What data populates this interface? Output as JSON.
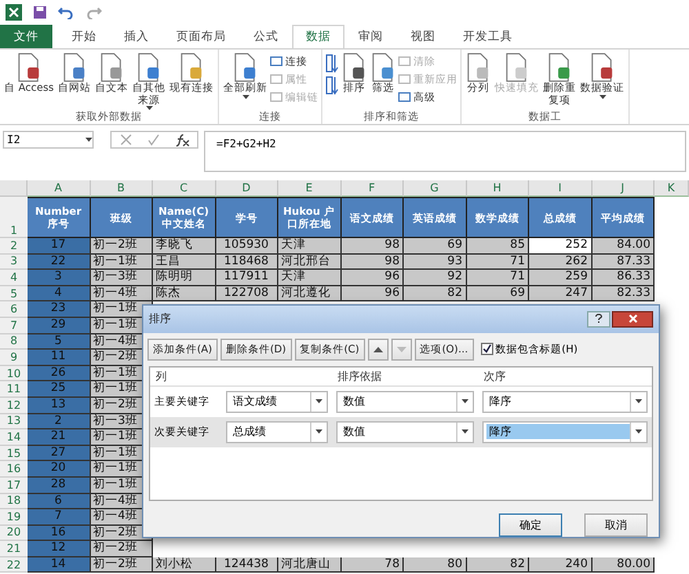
{
  "tabs": [
    {
      "label": "文件",
      "kind": "file",
      "selected": false
    },
    {
      "label": "开始",
      "kind": "tab",
      "selected": false
    },
    {
      "label": "插入",
      "kind": "tab",
      "selected": false
    },
    {
      "label": "页面布局",
      "kind": "tab",
      "selected": false
    },
    {
      "label": "公式",
      "kind": "tab",
      "selected": false
    },
    {
      "label": "数据",
      "kind": "tab",
      "selected": true
    },
    {
      "label": "审阅",
      "kind": "tab",
      "selected": false
    },
    {
      "label": "视图",
      "kind": "tab",
      "selected": false
    },
    {
      "label": "开发工具",
      "kind": "tab",
      "selected": false
    }
  ],
  "ribbon": {
    "groups": [
      {
        "title": "获取外部数据",
        "items": [
          {
            "kind": "large",
            "label": "自 Access",
            "dropdown": false
          },
          {
            "kind": "large",
            "label": "自网站",
            "dropdown": false
          },
          {
            "kind": "large",
            "label": "自文本",
            "dropdown": false
          },
          {
            "kind": "large",
            "label": "自其他来源",
            "dropdown": true
          },
          {
            "kind": "large",
            "label": "现有连接",
            "dropdown": false
          }
        ]
      },
      {
        "title": "连接",
        "items": [
          {
            "kind": "large",
            "label": "全部刷新",
            "dropdown": true
          },
          {
            "kind": "small",
            "label": "连接",
            "disabled": false
          },
          {
            "kind": "small",
            "label": "属性",
            "disabled": true
          },
          {
            "kind": "small",
            "label": "编辑链",
            "disabled": true
          }
        ]
      },
      {
        "title": "排序和筛选",
        "items": [
          {
            "kind": "sortpair"
          },
          {
            "kind": "large",
            "label": "排序",
            "dropdown": false
          },
          {
            "kind": "large",
            "label": "筛选",
            "dropdown": false
          },
          {
            "kind": "small",
            "label": "清除",
            "disabled": true
          },
          {
            "kind": "small",
            "label": "重新应用",
            "disabled": true
          },
          {
            "kind": "small",
            "label": "高级",
            "disabled": false
          }
        ]
      },
      {
        "title": "数据工",
        "items": [
          {
            "kind": "large",
            "label": "分列",
            "dropdown": false,
            "disabled": false
          },
          {
            "kind": "large",
            "label": "快速填充",
            "dropdown": false,
            "disabled": true
          },
          {
            "kind": "large",
            "label": "删除重复项",
            "dropdown": false,
            "disabled": false
          },
          {
            "kind": "large",
            "label": "数据验证",
            "dropdown": true,
            "disabled": false
          }
        ]
      }
    ]
  },
  "formula_bar": {
    "name_box": "I2",
    "formula": "=F2+G2+H2"
  },
  "sheet": {
    "columns": [
      "A",
      "B",
      "C",
      "D",
      "E",
      "F",
      "G",
      "H",
      "I",
      "J",
      "K"
    ],
    "header_row": {
      "number": "1",
      "cells": [
        "Number 序号",
        "班级",
        "Name(C) 中文姓名",
        "学号",
        "Hukou 户口所在地",
        "语文成绩",
        "英语成绩",
        "数学成绩",
        "总成绩",
        "平均成绩"
      ]
    },
    "rows": [
      {
        "number": "2",
        "cells": [
          "17",
          "初一2班",
          "李晓飞",
          "105930",
          "天津",
          "98",
          "69",
          "85",
          {
            "text": "252",
            "active": true
          },
          "84.00"
        ]
      },
      {
        "number": "3",
        "cells": [
          "22",
          "初一1班",
          "王昌",
          "118468",
          "河北邢台",
          "98",
          "93",
          "71",
          "262",
          "87.33"
        ]
      },
      {
        "number": "4",
        "cells": [
          "3",
          "初一3班",
          "陈明明",
          "117911",
          "天津",
          "96",
          "92",
          "71",
          "259",
          "86.33"
        ]
      },
      {
        "number": "5",
        "cells": [
          "4",
          "初一4班",
          "陈杰",
          "122708",
          "河北遵化",
          "96",
          "82",
          "69",
          "247",
          "82.33"
        ]
      },
      {
        "number": "6",
        "cells": [
          "23",
          "初一1班"
        ]
      },
      {
        "number": "7",
        "cells": [
          "29",
          "初一1班"
        ]
      },
      {
        "number": "8",
        "cells": [
          "5",
          "初一4班"
        ]
      },
      {
        "number": "9",
        "cells": [
          "11",
          "初一2班"
        ]
      },
      {
        "number": "10",
        "cells": [
          "26",
          "初一1班"
        ]
      },
      {
        "number": "11",
        "cells": [
          "25",
          "初一1班"
        ]
      },
      {
        "number": "12",
        "cells": [
          "13",
          "初一2班"
        ]
      },
      {
        "number": "13",
        "cells": [
          "2",
          "初一3班"
        ]
      },
      {
        "number": "14",
        "cells": [
          "21",
          "初一1班"
        ]
      },
      {
        "number": "15",
        "cells": [
          "27",
          "初一1班"
        ]
      },
      {
        "number": "16",
        "cells": [
          "20",
          "初一1班"
        ]
      },
      {
        "number": "17",
        "cells": [
          "28",
          "初一1班"
        ]
      },
      {
        "number": "18",
        "cells": [
          "6",
          "初一4班"
        ]
      },
      {
        "number": "19",
        "cells": [
          "7",
          "初一4班"
        ]
      },
      {
        "number": "20",
        "cells": [
          "16",
          "初一2班"
        ]
      },
      {
        "number": "21",
        "cells": [
          "12",
          "初一2班"
        ]
      },
      {
        "number": "22",
        "cells": [
          "14",
          "初一2班",
          "刘小松",
          "124438",
          "河北唐山",
          "78",
          "80",
          "82",
          "240",
          "80.00"
        ]
      }
    ]
  },
  "dialog": {
    "title": "排序",
    "toolbar": [
      {
        "kind": "button",
        "label": "添加条件(A)",
        "disabled": false
      },
      {
        "kind": "button",
        "label": "删除条件(D)",
        "disabled": false
      },
      {
        "kind": "button",
        "label": "复制条件(C)",
        "disabled": false
      },
      {
        "kind": "up",
        "disabled": false
      },
      {
        "kind": "down",
        "disabled": true
      },
      {
        "kind": "button",
        "label": "选项(O)...",
        "disabled": false
      }
    ],
    "header_option": {
      "label": "数据包含标题(H)",
      "checked": true
    },
    "columns": [
      "列",
      "排序依据",
      "次序"
    ],
    "levels": [
      {
        "label": "主要关键字",
        "column": "语文成绩",
        "sort_on": "数值",
        "order": "降序",
        "selected": false
      },
      {
        "label": "次要关键字",
        "column": "总成绩",
        "sort_on": "数值",
        "order": "降序",
        "selected": true
      }
    ],
    "buttons": [
      "确定",
      "取消"
    ]
  }
}
